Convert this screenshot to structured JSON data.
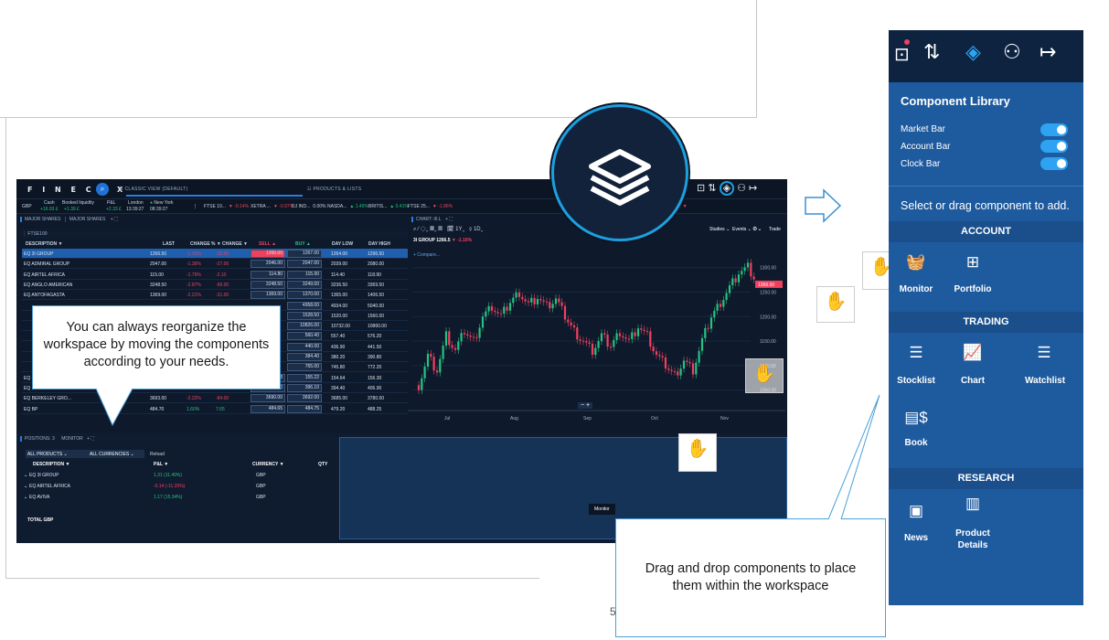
{
  "main": {
    "logo": "F I N E C O X",
    "view_tab": "CLASSIC VIEW (DEFAULT)",
    "products_tab": "PRODUCTS & LISTS",
    "account": {
      "ccy": "GBP",
      "cash_label": "Cash",
      "cash_val": "+16.93 £",
      "booked_label": "Booked liquidity",
      "booked_val": "+1.39 £",
      "pl_label": "P&L",
      "pl_val": "+2.33 £",
      "london": "London",
      "london_time": "13:39:27",
      "ny": "New York",
      "ny_time": "08:39:27"
    },
    "tickers": [
      {
        "name": "FTSE 10...",
        "chg": "▼ -0.14%",
        "dir": "dn"
      },
      {
        "name": "XETRA ...",
        "chg": "▼ -0.97%",
        "dir": "dn"
      },
      {
        "name": "DJ IND...",
        "chg": "0.00%",
        "dir": "flat"
      },
      {
        "name": "NASDA...",
        "chg": "▲ 1.45%",
        "dir": "up"
      },
      {
        "name": "BRITIS...",
        "chg": "▲ 0.41%",
        "dir": "up"
      },
      {
        "name": "FTSE 25...",
        "chg": "▼ -1.86%",
        "dir": "dn"
      },
      {
        "name": "5...",
        "chg": "▼ -0.49%",
        "dir": "dn"
      },
      {
        "name": "AEX IN...",
        "chg": "▼",
        "dir": "dn"
      }
    ],
    "tabs": [
      "MAJOR SHARES",
      "MAJOR SHARES"
    ],
    "list_title": "FTSE100",
    "columns": [
      "DESCRIPTION ▼",
      "LAST",
      "CHANGE % ▼",
      "CHANGE ▼",
      "SELL ▲",
      "BUY ▲",
      "DAY LOW",
      "DAY HIGH"
    ],
    "rows": [
      {
        "desc": "EQ 3I GROUP",
        "last": "1266.50",
        "pct": "-1.16%",
        "chg": "-15.00",
        "sell": "1266.00",
        "buy": "1267.00",
        "low": "1264.00",
        "high": "1296.50",
        "dir": "dn",
        "sel": true
      },
      {
        "desc": "EQ ADMIRAL GROUP",
        "last": "2047.00",
        "pct": "-1.30%",
        "chg": "-27.00",
        "sell": "2046.00",
        "buy": "2047.00",
        "low": "2039.00",
        "high": "2080.00",
        "dir": "dn"
      },
      {
        "desc": "EQ AIRTEL AFRICA",
        "last": "115.00",
        "pct": "-1.79%",
        "chg": "-2.10",
        "sell": "114.80",
        "buy": "115.00",
        "low": "114.40",
        "high": "118.90",
        "dir": "dn"
      },
      {
        "desc": "EQ ANGLO AMERICAN",
        "last": "3248.50",
        "pct": "-2.87%",
        "chg": "-96.00",
        "sell": "3248.50",
        "buy": "3249.00",
        "low": "3236.50",
        "high": "3369.50",
        "dir": "dn"
      },
      {
        "desc": "EQ ANTOFAGASTA",
        "last": "1369.00",
        "pct": "-2.21%",
        "chg": "-31.00",
        "sell": "1369.00",
        "buy": "1370.00",
        "low": "1365.00",
        "high": "1406.50",
        "dir": "dn"
      },
      {
        "desc": "",
        "last": "",
        "pct": "",
        "chg": "",
        "sell": "",
        "buy": "4958.00",
        "low": "4934.00",
        "high": "5040.00",
        "dir": "dn"
      },
      {
        "desc": "",
        "last": "",
        "pct": "",
        "chg": "",
        "sell": "",
        "buy": "1528.50",
        "low": "1520.00",
        "high": "1560.00",
        "dir": "dn"
      },
      {
        "desc": "",
        "last": "",
        "pct": "",
        "chg": "",
        "sell": "",
        "buy": "10826.00",
        "low": "10732.00",
        "high": "10860.00",
        "dir": "dn"
      },
      {
        "desc": "",
        "last": "",
        "pct": "",
        "chg": "",
        "sell": "",
        "buy": "560.40",
        "low": "557.40",
        "high": "576.20",
        "dir": "dn"
      },
      {
        "desc": "",
        "last": "",
        "pct": "",
        "chg": "",
        "sell": "",
        "buy": "440.00",
        "low": "436.90",
        "high": "441.50",
        "dir": "dn"
      },
      {
        "desc": "",
        "last": "",
        "pct": "",
        "chg": "",
        "sell": "",
        "buy": "384.40",
        "low": "380.20",
        "high": "390.80",
        "dir": "dn"
      },
      {
        "desc": "",
        "last": "",
        "pct": "",
        "chg": "",
        "sell": "",
        "buy": "765.00",
        "low": "745.80",
        "high": "772.20",
        "dir": "dn"
      },
      {
        "desc": "EQ BARCL...",
        "last": "155.20",
        "pct": "-1.28%",
        "chg": "-2.02",
        "sell": "155.18",
        "buy": "155.22",
        "low": "154.64",
        "high": "156.30",
        "dir": "dn"
      },
      {
        "desc": "EQ BARRATT D...",
        "last": "396.0706",
        "pct": "-2.12%",
        "chg": "-8.60",
        "sell": "395.80",
        "buy": "396.10",
        "low": "394.40",
        "high": "406.90",
        "dir": "dn"
      },
      {
        "desc": "EQ BERKELEY GRO...",
        "last": "3693.00",
        "pct": "-2.22%",
        "chg": "-84.00",
        "sell": "3690.00",
        "buy": "3692.00",
        "low": "3685.00",
        "high": "3780.00",
        "dir": "dn"
      },
      {
        "desc": "EQ BP",
        "last": "484.70",
        "pct": "1.60%",
        "chg": "7.65",
        "sell": "484.65",
        "buy": "484.75",
        "low": "479.20",
        "high": "488.25",
        "dir": "up"
      }
    ],
    "chart_tab": "CHART: III.L",
    "chart_symbol": "3I GROUP",
    "chart_price": "1266.5",
    "chart_change": "▼ -1.16%",
    "compare": "+ Compare...",
    "interval": "1Y",
    "period": "1D",
    "studies": "Studies",
    "events": "Events",
    "trade": "Trade",
    "y_ticks": [
      "1300.00",
      "1250.00",
      "1200.00",
      "1150.00",
      "1100.00",
      "1050.00"
    ],
    "price_tag": "1266.50",
    "x_ticks": [
      "Jul",
      "Aug",
      "Sep",
      "Oct",
      "Nov"
    ],
    "zoom_ctrl": "− +",
    "bottom_tabs": [
      "POSITIONS: 3",
      "MONITOR"
    ],
    "filters": [
      "ALL PRODUCTS",
      "ALL CURRENCIES",
      "Reload"
    ],
    "pos_cols": [
      "DESCRIPTION ▼",
      "P&L ▼",
      "CURRENCY ▼",
      "QTY"
    ],
    "positions": [
      {
        "desc": "EQ 3I GROUP",
        "pl": "1.31 (11.49%)",
        "ccy": "GBP",
        "dir": "up"
      },
      {
        "desc": "EQ AIRTEL AFRICA",
        "pl": "-0.14 (-11.20%)",
        "ccy": "GBP",
        "dir": "dn"
      },
      {
        "desc": "EQ AVIVA",
        "pl": "1.17 (15.34%)",
        "ccy": "GBP",
        "dir": "up"
      }
    ],
    "total": "TOTAL GBP",
    "monitor_ghost": "Monitor"
  },
  "callouts": {
    "reorganize": "You can always reorganize the workspace by moving the components according to your needs.",
    "drag": "Drag and drop components to place them within the workspace"
  },
  "page_number": "5",
  "library": {
    "title": "Component Library",
    "toggles": [
      "Market Bar",
      "Account Bar",
      "Clock Bar"
    ],
    "hint": "Select or drag component to add.",
    "sections": [
      {
        "title": "ACCOUNT",
        "items": [
          "Monitor",
          "Portfolio"
        ]
      },
      {
        "title": "TRADING",
        "items": [
          "Stocklist",
          "Chart",
          "Watchlist",
          "Book"
        ]
      },
      {
        "title": "RESEARCH",
        "items": [
          "News",
          "Product Details"
        ]
      }
    ]
  },
  "colors": {
    "accent": "#2ea3f2",
    "panel": "#1e5a9e",
    "dark": "#0e1a2c",
    "up": "#26c281",
    "down": "#f0405e"
  }
}
